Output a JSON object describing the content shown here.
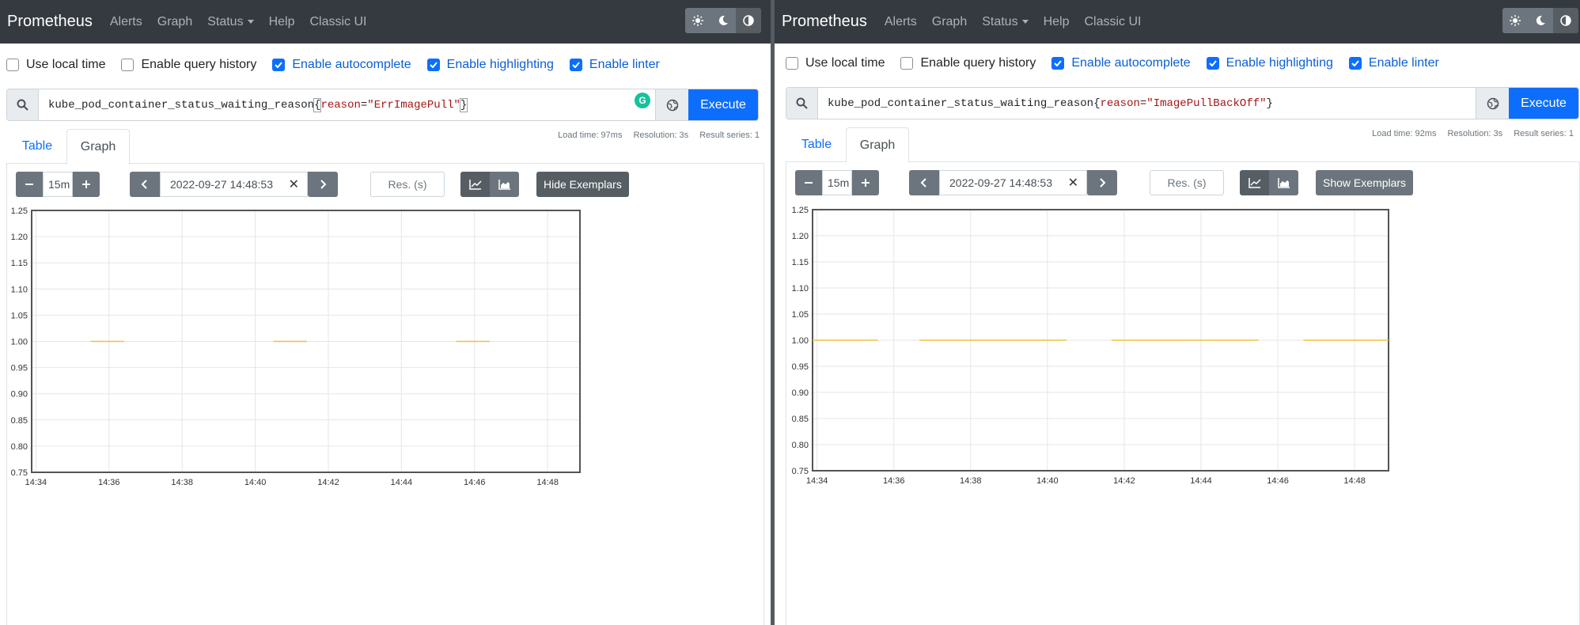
{
  "navbar": {
    "brand": "Prometheus",
    "links": [
      "Alerts",
      "Graph",
      "Status",
      "Help",
      "Classic UI"
    ],
    "theme_icons": [
      "sun-icon",
      "moon-icon",
      "contrast-icon"
    ]
  },
  "options": {
    "use_local_time": {
      "label": "Use local time",
      "checked": false
    },
    "query_history": {
      "label": "Enable query history",
      "checked": false
    },
    "autocomplete": {
      "label": "Enable autocomplete",
      "checked": true
    },
    "highlighting": {
      "label": "Enable highlighting",
      "checked": true
    },
    "linter": {
      "label": "Enable linter",
      "checked": true
    }
  },
  "execute_label": "Execute",
  "tabs": {
    "table": "Table",
    "graph": "Graph"
  },
  "res_placeholder": "Res. (s)",
  "panels": [
    {
      "query": {
        "metric": "kube_pod_container_status_waiting_reason",
        "open": "{",
        "label": "reason",
        "eq": "=",
        "value": "\"ErrImagePull\"",
        "close": "}"
      },
      "stats": {
        "load_time": "Load time: 97ms",
        "resolution": "Resolution: 3s",
        "result_series": "Result series: 1"
      },
      "range": "15m",
      "end_time": "2022-09-27 14:48:53",
      "exemplar_button": "Hide Exemplars",
      "grammarly_label": "G",
      "chart_data": {
        "type": "line",
        "ylim": [
          0.75,
          1.25
        ],
        "y_ticks": [
          "0.75",
          "0.80",
          "0.85",
          "0.90",
          "0.95",
          "1.00",
          "1.05",
          "1.10",
          "1.15",
          "1.20",
          "1.25"
        ],
        "x_ticks": [
          "14:34",
          "14:36",
          "14:38",
          "14:40",
          "14:42",
          "14:44",
          "14:46",
          "14:48"
        ],
        "series": [
          {
            "color": "#edc240",
            "segments": [
              {
                "x": [
                  "14:35:30",
                  "14:36:25"
                ],
                "y": [
                  1,
                  1
                ]
              },
              {
                "x": [
                  "14:40:30",
                  "14:41:25"
                ],
                "y": [
                  1,
                  1
                ]
              },
              {
                "x": [
                  "14:45:30",
                  "14:46:25"
                ],
                "y": [
                  1,
                  1
                ]
              }
            ]
          }
        ]
      }
    },
    {
      "query": {
        "metric": "kube_pod_container_status_waiting_reason",
        "open": "{",
        "label": "reason",
        "eq": "=",
        "value": "\"ImagePullBackOff\"",
        "close": "}"
      },
      "stats": {
        "load_time": "Load time: 92ms",
        "resolution": "Resolution: 3s",
        "result_series": "Result series: 1"
      },
      "range": "15m",
      "end_time": "2022-09-27 14:48:53",
      "exemplar_button": "Show Exemplars",
      "chart_data": {
        "type": "line",
        "ylim": [
          0.75,
          1.25
        ],
        "y_ticks": [
          "0.75",
          "0.80",
          "0.85",
          "0.90",
          "0.95",
          "1.00",
          "1.05",
          "1.10",
          "1.15",
          "1.20",
          "1.25"
        ],
        "x_ticks": [
          "14:34",
          "14:36",
          "14:38",
          "14:40",
          "14:42",
          "14:44",
          "14:46",
          "14:48"
        ],
        "series": [
          {
            "color": "#edc240",
            "segments": [
              {
                "x": [
                  "14:33:53",
                  "14:35:35"
                ],
                "y": [
                  1,
                  1
                ]
              },
              {
                "x": [
                  "14:36:40",
                  "14:40:30"
                ],
                "y": [
                  1,
                  1
                ]
              },
              {
                "x": [
                  "14:41:40",
                  "14:45:30"
                ],
                "y": [
                  1,
                  1
                ]
              },
              {
                "x": [
                  "14:46:40",
                  "14:48:53"
                ],
                "y": [
                  1,
                  1
                ]
              }
            ]
          }
        ]
      }
    }
  ]
}
